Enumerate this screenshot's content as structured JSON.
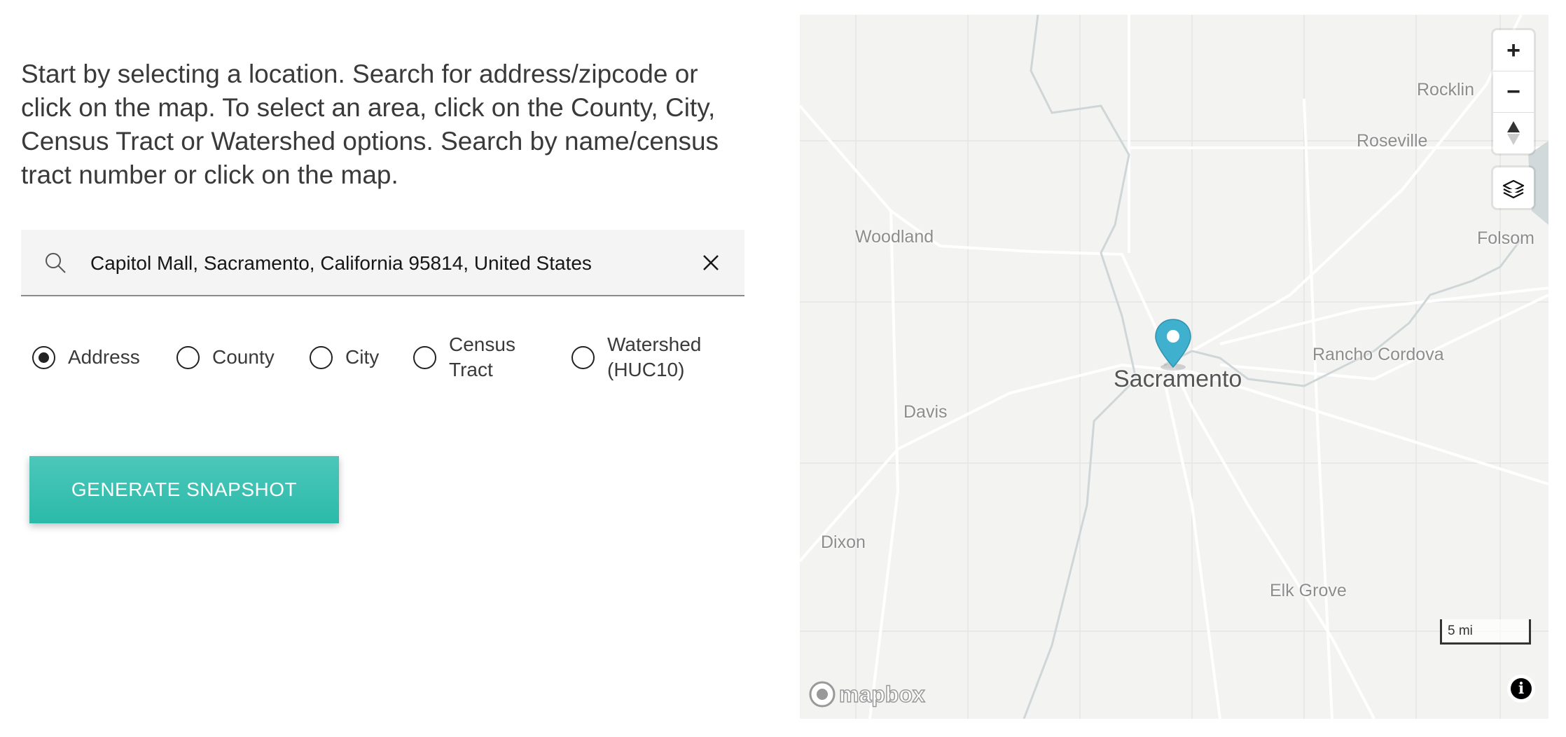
{
  "intro_text": "Start by selecting a location. Search for address/zipcode or click on the map. To select an area, click on the County, City, Census Tract or Watershed options. Search by name/census tract number or click on the map.",
  "search": {
    "value": "Capitol Mall, Sacramento, California 95814, United States",
    "icon": "search-icon",
    "clear_icon": "close-icon"
  },
  "location_types": [
    {
      "label": "Address",
      "selected": true
    },
    {
      "label": "County",
      "selected": false
    },
    {
      "label": "City",
      "selected": false
    },
    {
      "label": "Census Tract",
      "selected": false
    },
    {
      "label": "Watershed (HUC10)",
      "selected": false
    }
  ],
  "generate_button": "GENERATE SNAPSHOT",
  "map": {
    "places": [
      "Woodland",
      "Davis",
      "Dixon",
      "Sacramento",
      "Rancho Cordova",
      "Elk Grove",
      "Rocklin",
      "Roseville",
      "Folsom"
    ],
    "controls": {
      "zoom_in": "+",
      "zoom_out": "−",
      "compass": "compass-icon",
      "layers": "layers-icon"
    },
    "scale": "5 mi",
    "attribution_logo": "mapbox",
    "marker_color": "#3fb1ce"
  },
  "colors": {
    "accent": "#2bbaa9"
  }
}
